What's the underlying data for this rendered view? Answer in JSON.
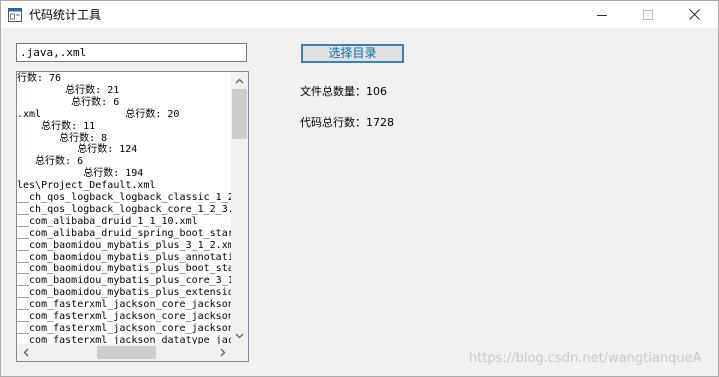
{
  "window": {
    "title": "代码统计工具"
  },
  "controls": {
    "extensions_value": ".java,.xml",
    "choose_dir_label": "选择目录",
    "file_count_text": "文件总数量：106",
    "code_lines_text": "代码总行数：1728"
  },
  "output": {
    "lines": [
      "行数: 76",
      "        总行数: 21",
      "         总行数: 6",
      ".xml              总行数: 20",
      "    总行数: 11",
      "       总行数: 8",
      "          总行数: 124",
      "   总行数: 6",
      "           总行数: 194",
      "les\\Project_Default.xml              总",
      "__ch_qos_logback_logback_classic_1_2_",
      "__ch_qos_logback_logback_core_1_2_3.",
      "__com_alibaba_druid_1_1_10.xml",
      "__com_alibaba_druid_spring_boot_star",
      "__com_baomidou_mybatis_plus_3_1_2.xm",
      "__com_baomidou_mybatis_plus_annotati",
      "__com_baomidou_mybatis_plus_boot_sta",
      "__com_baomidou_mybatis_plus_core_3_1",
      "__com_baomidou_mybatis_plus_extensio",
      "__com_fasterxml_jackson_core_jackson",
      "__com_fasterxml_jackson_core_jackson",
      "__com_fasterxml_jackson_core_jackson",
      "__com_fasterxml_jackson_datatype_jac"
    ]
  },
  "watermark": "https://blog.csdn.net/wangtianqueA"
}
